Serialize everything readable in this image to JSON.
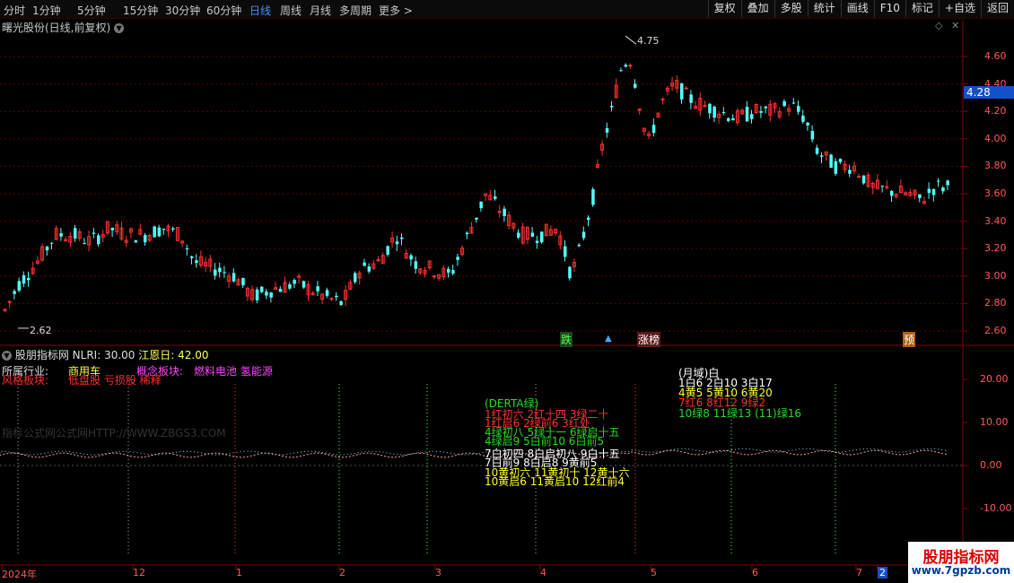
{
  "toolbar": {
    "periods": [
      "分时",
      "1分钟",
      "5分钟",
      "15分钟",
      "30分钟",
      "60分钟",
      "日线",
      "周线",
      "月线",
      "多周期",
      "更多 >"
    ],
    "active_period": "日线",
    "buttons": [
      "复权",
      "叠加",
      "多股",
      "统计",
      "画线",
      "F10",
      "标记",
      "+自选",
      "返回"
    ]
  },
  "chart": {
    "stock_title": "曙光股份(日线,前复权)",
    "collapse_icon": "chevron-down-icon",
    "right_icons": [
      "diamond-icon",
      "close-icon"
    ],
    "price_axis": [
      "4.60",
      "4.40",
      "4.20",
      "4.00",
      "3.80",
      "3.60",
      "3.40",
      "3.20",
      "3.00",
      "2.80",
      "2.60"
    ],
    "current_price": "4.28",
    "high_label": "4.75",
    "low_label": "2.62",
    "tags": {
      "die": "跌",
      "zhangting": "涨榜",
      "yu": "预"
    },
    "colors": {
      "up": "#ff3030",
      "down": "#54ffff",
      "grid": "#5a0000",
      "axis": "#8b0000",
      "price_highlight": "#1450c8"
    }
  },
  "indicator": {
    "name": "股朋指标网",
    "nlri_label": "NLRI: 30.00",
    "jiang_label": "江恩日: 42.00",
    "industry_label": "所属行业:",
    "industry_value": "商用车",
    "concept_label": "概念板块:",
    "concept_value": "燃料电池 氢能源",
    "style_label": "风格板块:",
    "style_value": "低盘股 亏损股 稀释",
    "axis": [
      "20.00",
      "10.00",
      "0.00",
      "-10.00"
    ],
    "watermark_text": "指标公式网公式网HTTP://WWW.ZBGS3.COM",
    "derta": {
      "title": "(DERTA绿)",
      "rows_red": [
        "1红初六  2红十四  3绿二十",
        "1红启6  2绿前6  3红处"
      ],
      "rows_green": [
        "4绿初八  5绿十一  6绿启十五",
        "4绿启9  5白前10  6白前5"
      ],
      "rows_white": [
        "7白初四  8白启初八  9白十五",
        "7白前9  8白启8  9黄前5"
      ],
      "rows_yellow": [
        "10黄初六  11黄初十  12黄十六",
        "10黄启6  11黄启10  12红前4"
      ]
    },
    "yuedu": {
      "title": "(月域)白",
      "row1": "1白6  2白10  3白17",
      "row2": "4黄5  5黄10  6黄20",
      "row3": "7红6  8红12  9绿2",
      "row4": "10绿8  11绿13  (11)绿16"
    }
  },
  "date_axis": [
    "2024年",
    "12",
    "1",
    "2",
    "3",
    "4",
    "5",
    "6",
    "7",
    "2"
  ],
  "watermark": {
    "title": "股朋指标网",
    "url": "www.7gpzb.com"
  }
}
